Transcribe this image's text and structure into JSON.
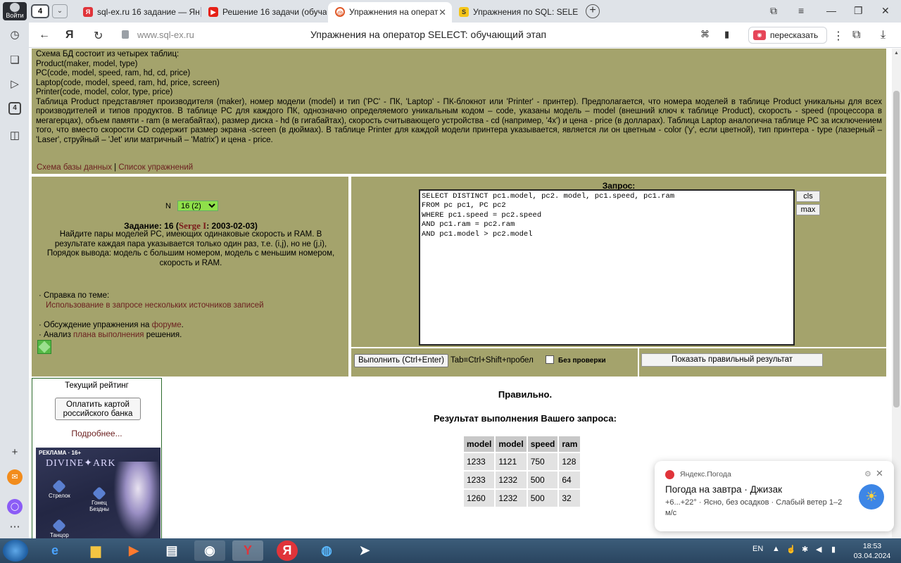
{
  "browser": {
    "login_label": "Войти",
    "tab_count": "4",
    "tabs": [
      {
        "title": "sql-ex.ru 16 задание — Ян",
        "icon": "yandex-icon",
        "active": false
      },
      {
        "title": "Решение 16 задачи (обуча",
        "icon": "youtube-icon",
        "active": false
      },
      {
        "title": "Упражнения на операт",
        "icon": "sqlex-icon",
        "active": true
      },
      {
        "title": "Упражнения по SQL: SELE",
        "icon": "sqlex-yellow-icon",
        "active": false
      }
    ],
    "url": "www.sql-ex.ru",
    "page_title": "Упражнения на оператор SELECT: обучающий этап",
    "retell_label": "пересказать",
    "sidebar_badge": "4"
  },
  "schema": {
    "intro": "Схема БД состоит из четырех таблиц:",
    "tables": [
      "Product(maker, model, type)",
      "PC(code, model, speed, ram, hd, cd, price)",
      "Laptop(code, model, speed, ram, hd, price, screen)",
      "Printer(code, model, color, type, price)"
    ],
    "description": "Таблица Product представляет производителя (maker), номер модели (model) и тип ('PC' - ПК, 'Laptop' - ПК-блокнот или 'Printer' - принтер). Предполагается, что номера моделей в таблице Product уникальны для всех производителей и типов продуктов. В таблице PC для каждого ПК, однозначно определяемого уникальным кодом – code, указаны модель – model (внешний ключ к таблице Product), скорость - speed (процессора в мегагерцах), объем памяти - ram (в мегабайтах), размер диска - hd (в гигабайтах), скорость считывающего устройства - cd (например, '4x') и цена - price (в долларах). Таблица Laptop аналогична таблице PC за исключением того, что вместо скорости CD содержит размер экрана -screen (в дюймах). В таблице Printer для каждой модели принтера указывается, является ли он цветным - color ('y', если цветной), тип принтера - type (лазерный – 'Laser', струйный – 'Jet' или матричный – 'Matrix') и цена - price.",
    "link_schema": "Схема базы данных",
    "link_separator": " | ",
    "link_list": "Список упражнений"
  },
  "task": {
    "n_label": "N",
    "n_value": "16 (2)",
    "title_prefix": "Задание: 16 (",
    "author": "Serge I",
    "title_suffix": ": 2003-02-03)",
    "text": "Найдите пары моделей PC, имеющих одинаковые скорость и RAM. В результате каждая пара указывается только один раз, т.е. (i,j), но не (j,i), Порядок вывода: модель с большим номером, модель с меньшим номером, скорость и RAM.",
    "help_label": "· Справка по теме:",
    "help_link": "Использование в запросе нескольких источников записей",
    "forum_prefix": "· Обсуждение упражнения на ",
    "forum_link": "форуме",
    "forum_suffix": ".",
    "plan_prefix": "· Анализ ",
    "plan_link": "плана выполнения",
    "plan_suffix": " решения."
  },
  "query": {
    "label": "Запрос:",
    "sql": "SELECT DISTINCT pc1.model, pc2. model, pc1.speed, pc1.ram\nFROM pc pc1, PC pc2\nWHERE pc1.speed = pc2.speed\nAND pc1.ram = pc2.ram\nAND pc1.model > pc2.model",
    "cls_label": "cls",
    "max_label": "max",
    "run_label": "Выполнить (Ctrl+Enter)",
    "tab_hint": "Tab≡Ctrl+Shift+пробел",
    "no_check_label": "Без проверки",
    "show_correct_label": "Показать правильный результат"
  },
  "rating": {
    "title": "Текущий рейтинг",
    "pay_label": "Оплатить картой российского банка",
    "more_label": "Подробнее...",
    "ad_label": "РЕКЛАМА · 16+",
    "ad_brand": "DIVINE✦ARK",
    "ad_class1": "Стрелок",
    "ad_class2": "Гонец Бездны",
    "ad_class3": "Танцор"
  },
  "result": {
    "status": "Правильно.",
    "title": "Результат выполнения Вашего запроса:",
    "columns": [
      "model",
      "model",
      "speed",
      "ram"
    ],
    "rows": [
      [
        "1233",
        "1121",
        "750",
        "128"
      ],
      [
        "1233",
        "1232",
        "500",
        "64"
      ],
      [
        "1260",
        "1232",
        "500",
        "32"
      ]
    ]
  },
  "notification": {
    "source": "Яндекс.Погода",
    "headline": "Погода на завтра · Джизак",
    "body": "+6...+22° · Ясно, без осадков · Слабый ветер 1–2 м/с"
  },
  "taskbar": {
    "lang": "EN",
    "time": "18:53",
    "date": "03.04.2024"
  }
}
